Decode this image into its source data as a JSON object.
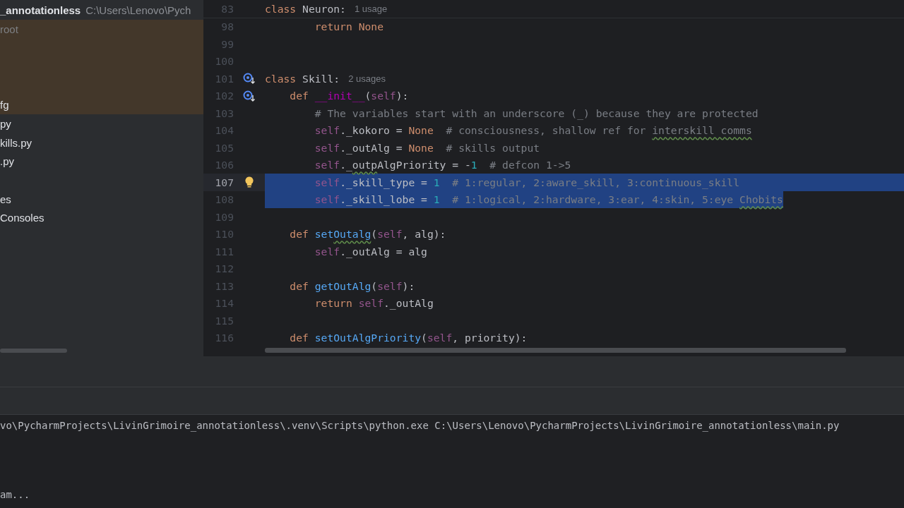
{
  "sidebar": {
    "title": "_annotationless",
    "path": "C:\\Users\\Lenovo\\Pych",
    "groups": [
      {
        "highlighted": true,
        "items": [
          "root",
          "fg"
        ]
      },
      {
        "highlighted": false,
        "items": [
          "py",
          "kills.py",
          ".py"
        ]
      },
      {
        "highlighted": false,
        "items": [
          "es",
          "Consoles"
        ]
      }
    ]
  },
  "editor": {
    "sticky_line": {
      "number": "83",
      "tokens": [
        {
          "kind": "keyword",
          "text": "class "
        },
        {
          "kind": "text",
          "text": "Neuron:"
        },
        {
          "kind": "hint",
          "text": "1 usage"
        }
      ]
    },
    "lines": [
      {
        "number": "98",
        "override_mark": false,
        "bulb": false,
        "selected": false,
        "current": false,
        "tokens": [
          {
            "kind": "keyword",
            "text": "        return None"
          }
        ]
      },
      {
        "number": "99",
        "override_mark": false,
        "bulb": false,
        "selected": false,
        "current": false
      },
      {
        "number": "100",
        "override_mark": false,
        "bulb": false,
        "selected": false,
        "current": false
      },
      {
        "number": "101",
        "override_mark": true,
        "bulb": false,
        "selected": false,
        "current": false,
        "tokens": [
          {
            "kind": "keyword",
            "text": "class "
          },
          {
            "kind": "text",
            "text": "Skill:"
          },
          {
            "kind": "hint",
            "text": "2 usages"
          }
        ]
      },
      {
        "number": "102",
        "override_mark": true,
        "bulb": false,
        "selected": false,
        "current": false,
        "tokens": [
          {
            "kind": "keyword",
            "text": "    def "
          },
          {
            "kind": "dunder",
            "text": "__init__"
          },
          {
            "kind": "text",
            "text": "("
          },
          {
            "kind": "self",
            "text": "self"
          },
          {
            "kind": "text",
            "text": "):"
          }
        ]
      },
      {
        "number": "103",
        "override_mark": false,
        "bulb": false,
        "selected": false,
        "current": false,
        "tokens": [
          {
            "kind": "comment",
            "text": "        # The variables start with an underscore (_) because they are protected"
          }
        ]
      },
      {
        "number": "104",
        "override_mark": false,
        "bulb": false,
        "selected": false,
        "current": false,
        "tokens": [
          {
            "kind": "self",
            "text": "        self"
          },
          {
            "kind": "text",
            "text": "._kokoro = "
          },
          {
            "kind": "keyword",
            "text": "None"
          },
          {
            "kind": "comment",
            "text": "  # consciousness, shallow ref for "
          },
          {
            "kind": "misspelled",
            "text": "interskill comms"
          }
        ]
      },
      {
        "number": "105",
        "override_mark": false,
        "bulb": false,
        "selected": false,
        "current": false,
        "tokens": [
          {
            "kind": "self",
            "text": "        self"
          },
          {
            "kind": "text",
            "text": "._outAlg = "
          },
          {
            "kind": "keyword",
            "text": "None"
          },
          {
            "kind": "comment",
            "text": "  # skills output"
          }
        ]
      },
      {
        "number": "106",
        "override_mark": false,
        "bulb": false,
        "selected": false,
        "current": false,
        "tokens": [
          {
            "kind": "self",
            "text": "        self"
          },
          {
            "kind": "text",
            "text": "._"
          },
          {
            "kind": "misspelledtext",
            "text": "outp"
          },
          {
            "kind": "text",
            "text": "AlgPriority = -"
          },
          {
            "kind": "number",
            "text": "1"
          },
          {
            "kind": "comment",
            "text": "  # defcon 1->5"
          }
        ]
      },
      {
        "number": "107",
        "override_mark": false,
        "bulb": true,
        "selected": true,
        "current": true,
        "tokens": [
          {
            "kind": "self",
            "text": "        self"
          },
          {
            "kind": "text",
            "text": "._skill_type = "
          },
          {
            "kind": "number",
            "text": "1"
          },
          {
            "kind": "comment",
            "text": "  # 1:regular, 2:aware_skill, 3:continuous_skill"
          }
        ]
      },
      {
        "number": "108",
        "override_mark": false,
        "bulb": false,
        "selected": true,
        "current": false,
        "tokens": [
          {
            "kind": "self",
            "text": "        self"
          },
          {
            "kind": "text",
            "text": "._skill_lobe = "
          },
          {
            "kind": "number",
            "text": "1"
          },
          {
            "kind": "comment",
            "text": "  # 1:logical, 2:hardware, 3:ear, 4:skin, 5:eye "
          },
          {
            "kind": "misspelled",
            "text": "Chobits"
          }
        ]
      },
      {
        "number": "109",
        "override_mark": false,
        "bulb": false,
        "selected": false,
        "current": false
      },
      {
        "number": "110",
        "override_mark": false,
        "bulb": false,
        "selected": false,
        "current": false,
        "tokens": [
          {
            "kind": "keyword",
            "text": "    def "
          },
          {
            "kind": "function",
            "text": "set"
          },
          {
            "kind": "misspelledname",
            "text": "Outalg"
          },
          {
            "kind": "text",
            "text": "("
          },
          {
            "kind": "self",
            "text": "self"
          },
          {
            "kind": "text",
            "text": ", alg):"
          }
        ]
      },
      {
        "number": "111",
        "override_mark": false,
        "bulb": false,
        "selected": false,
        "current": false,
        "tokens": [
          {
            "kind": "self",
            "text": "        self"
          },
          {
            "kind": "text",
            "text": "._outAlg = alg"
          }
        ]
      },
      {
        "number": "112",
        "override_mark": false,
        "bulb": false,
        "selected": false,
        "current": false
      },
      {
        "number": "113",
        "override_mark": false,
        "bulb": false,
        "selected": false,
        "current": false,
        "tokens": [
          {
            "kind": "keyword",
            "text": "    def "
          },
          {
            "kind": "function",
            "text": "getOutAlg"
          },
          {
            "kind": "text",
            "text": "("
          },
          {
            "kind": "self",
            "text": "self"
          },
          {
            "kind": "text",
            "text": "):"
          }
        ]
      },
      {
        "number": "114",
        "override_mark": false,
        "bulb": false,
        "selected": false,
        "current": false,
        "tokens": [
          {
            "kind": "keyword",
            "text": "        return "
          },
          {
            "kind": "self",
            "text": "self"
          },
          {
            "kind": "text",
            "text": "._outAlg"
          }
        ]
      },
      {
        "number": "115",
        "override_mark": false,
        "bulb": false,
        "selected": false,
        "current": false
      },
      {
        "number": "116",
        "override_mark": false,
        "bulb": false,
        "selected": false,
        "current": false,
        "tokens": [
          {
            "kind": "keyword",
            "text": "    def "
          },
          {
            "kind": "function",
            "text": "setOutAlgPriority"
          },
          {
            "kind": "text",
            "text": "("
          },
          {
            "kind": "self",
            "text": "self"
          },
          {
            "kind": "text",
            "text": ", priority):"
          }
        ]
      }
    ]
  },
  "console": {
    "lines": [
      "vo\\PycharmProjects\\LivinGrimoire_annotationless\\.venv\\Scripts\\python.exe C:\\Users\\Lenovo\\PycharmProjects\\LivinGrimoire_annotationless\\main.py",
      "am..."
    ]
  }
}
